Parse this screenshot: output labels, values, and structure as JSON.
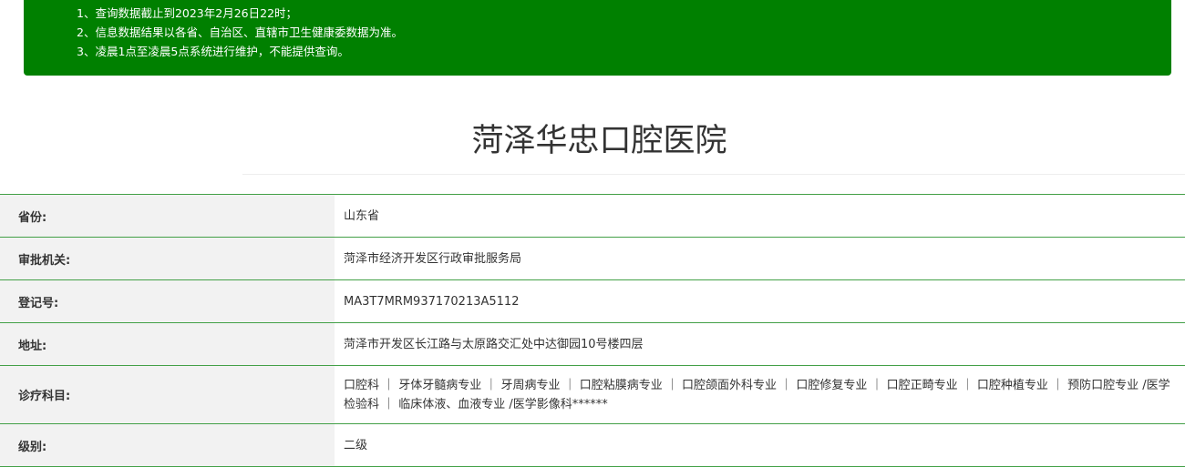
{
  "notice": {
    "lines": [
      "1、查询数据截止到2023年2月26日22时；",
      "2、信息数据结果以各省、自治区、直辖市卫生健康委数据为准。",
      "3、凌晨1点至凌晨5点系统进行维护，不能提供查询。"
    ]
  },
  "hospital": {
    "name": "菏泽华忠口腔医院"
  },
  "fields": [
    {
      "label": "省份:",
      "value": "山东省"
    },
    {
      "label": "审批机关:",
      "value": "菏泽市经济开发区行政审批服务局"
    },
    {
      "label": "登记号:",
      "value": "MA3T7MRM937170213A5112"
    },
    {
      "label": "地址:",
      "value": "菏泽市开发区长江路与太原路交汇处中达御园10号楼四层"
    },
    {
      "label": "诊疗科目:",
      "value": "口腔科 ｜ 牙体牙髓病专业 ｜ 牙周病专业 ｜ 口腔粘膜病专业 ｜ 口腔颌面外科专业 ｜ 口腔修复专业 ｜ 口腔正畸专业 ｜ 口腔种植专业 ｜ 预防口腔专业 /医学检验科 ｜ 临床体液、血液专业 /医学影像科******"
    },
    {
      "label": "级别:",
      "value": "二级"
    }
  ],
  "colors": {
    "notice_bg": "#008000",
    "row_border": "#43a047",
    "label_bg": "#f2f2f2"
  }
}
